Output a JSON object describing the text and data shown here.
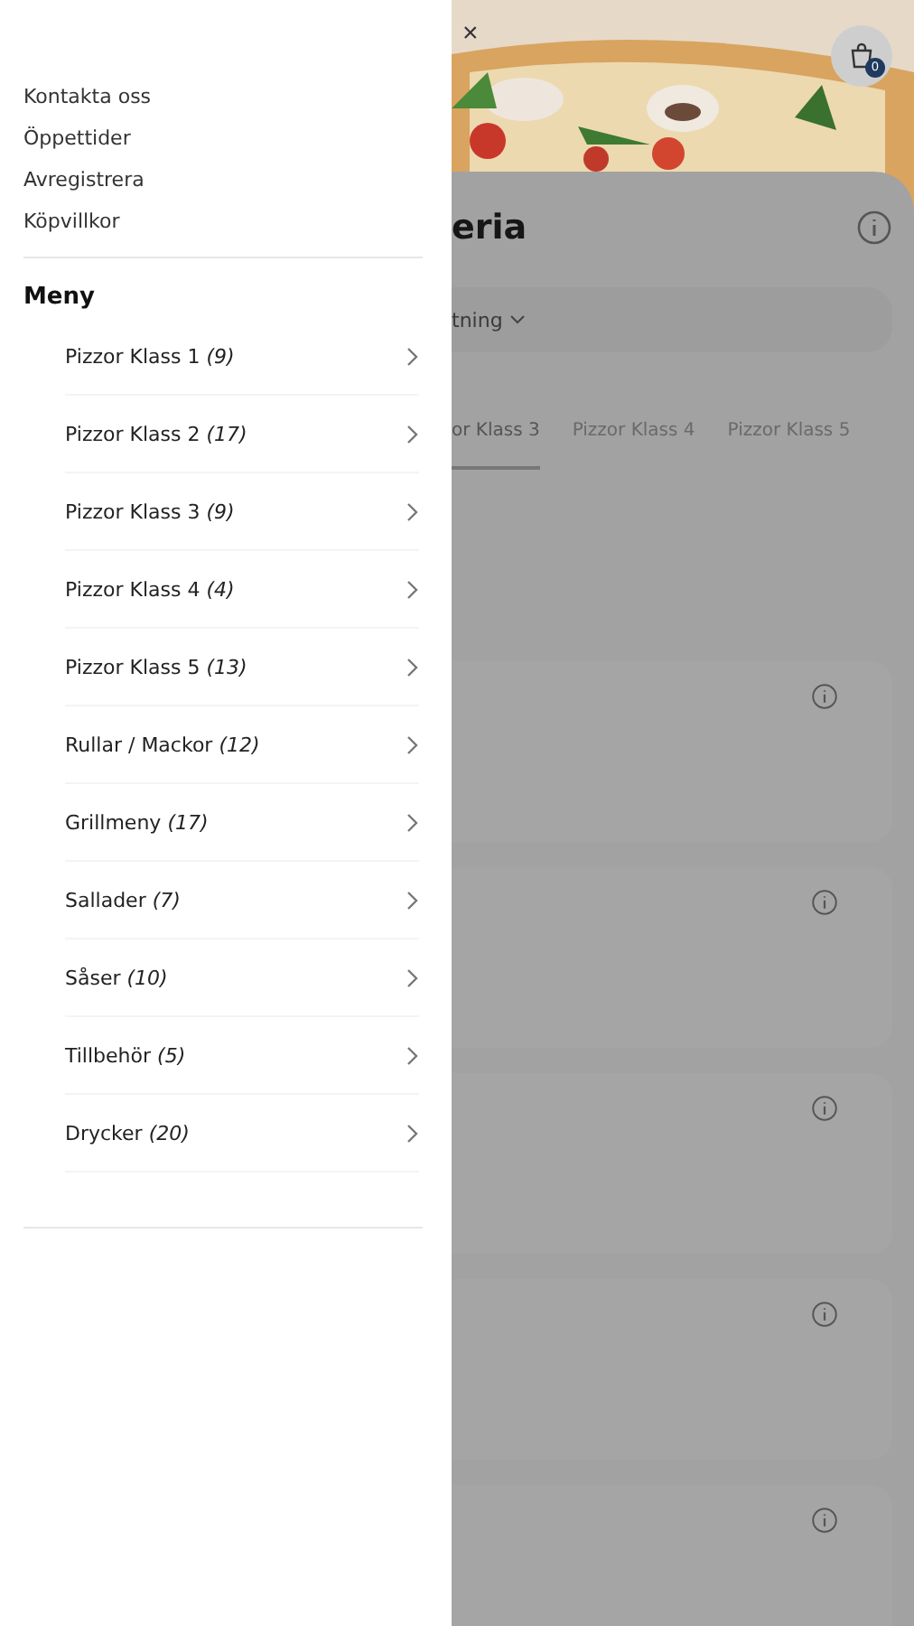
{
  "drawer": {
    "links": [
      "Kontakta oss",
      "Öppettider",
      "Avregistrera",
      "Köpvillkor"
    ],
    "menu_title": "Meny",
    "categories": [
      {
        "label": "Pizzor Klass 1 *(9)*"
      },
      {
        "label": "Pizzor Klass 2 *(17)*"
      },
      {
        "label": "Pizzor Klass 3 *(9)*"
      },
      {
        "label": "Pizzor Klass 4 *(4)*"
      },
      {
        "label": "Pizzor Klass 5 *(13)*"
      },
      {
        "label": "Rullar / Mackor *(12)*"
      },
      {
        "label": "Grillmeny *(17)*"
      },
      {
        "label": "Sallader *(7)*"
      },
      {
        "label": "Såser *(10)*"
      },
      {
        "label": "Tillbehör *(5)*"
      },
      {
        "label": "Drycker *(20)*"
      }
    ]
  },
  "background": {
    "close": "×",
    "cart_count": "0",
    "title": "eria",
    "dropdown": "tning",
    "tabs": [
      {
        "label": "or Klass 3",
        "selected": true
      },
      {
        "label": "Pizzor Klass 4",
        "selected": false
      },
      {
        "label": "Pizzor Klass 5",
        "selected": false
      }
    ],
    "cards": [
      {
        "kind": "product"
      },
      {
        "kind": "product"
      },
      {
        "kind": "product"
      },
      {
        "kind": "product"
      },
      {
        "kind": "product"
      }
    ]
  }
}
